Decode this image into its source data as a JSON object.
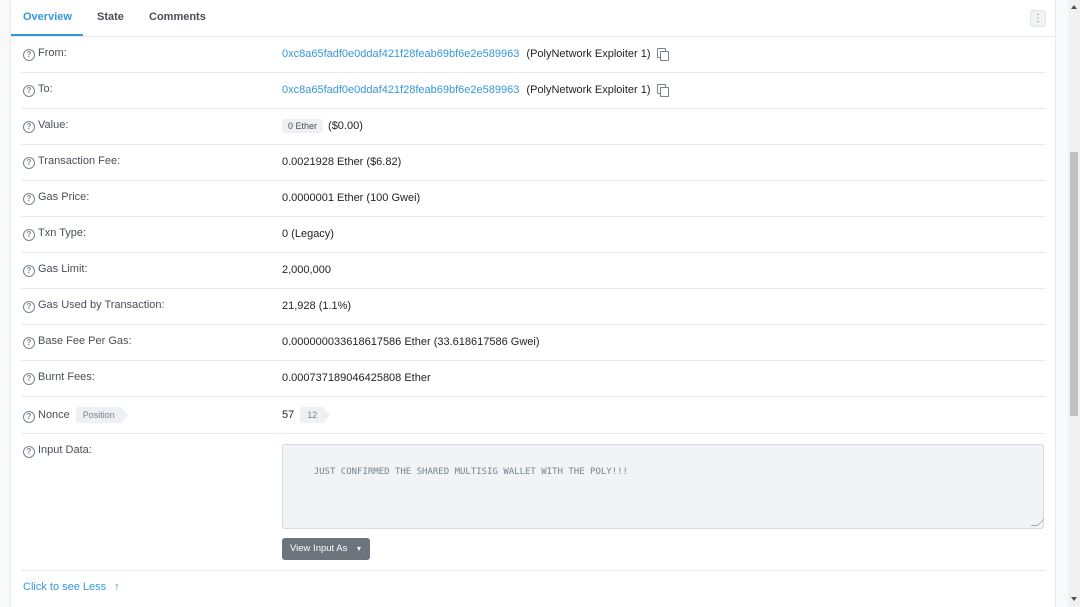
{
  "tabs": {
    "overview": "Overview",
    "state": "State",
    "comments": "Comments",
    "more_icon": "⋮"
  },
  "help_icon": "?",
  "rows": {
    "from": {
      "label": "From:",
      "address": "0xc8a65fadf0e0ddaf421f28feab69bf6e2e589963",
      "name": "(PolyNetwork Exploiter 1)"
    },
    "to": {
      "label": "To:",
      "address": "0xc8a65fadf0e0ddaf421f28feab69bf6e2e589963",
      "name": "(PolyNetwork Exploiter 1)"
    },
    "value": {
      "label": "Value:",
      "badge": "0 Ether",
      "usd": "($0.00)"
    },
    "txn_fee": {
      "label": "Transaction Fee:",
      "value": "0.0021928 Ether ($6.82)"
    },
    "gas_price": {
      "label": "Gas Price:",
      "value": "0.0000001 Ether (100 Gwei)"
    },
    "txn_type": {
      "label": "Txn Type:",
      "value": "0 (Legacy)"
    },
    "gas_limit": {
      "label": "Gas Limit:",
      "value": "2,000,000"
    },
    "gas_used": {
      "label": "Gas Used by Transaction:",
      "value": "21,928 (1.1%)"
    },
    "base_fee": {
      "label": "Base Fee Per Gas:",
      "value": "0.000000033618617586 Ether (33.618617586 Gwei)"
    },
    "burnt_fees": {
      "label": "Burnt Fees:",
      "value": "0.000737189046425808 Ether"
    },
    "nonce": {
      "label": "Nonce",
      "position_tag": "Position",
      "value": "57",
      "position": "12"
    },
    "input_data": {
      "label": "Input Data:",
      "text": "JUST CONFIRMED THE SHARED MULTISIG WALLET WITH THE POLY!!!"
    }
  },
  "view_input_as": {
    "label": "View Input As",
    "chevron": "▾"
  },
  "see_less": {
    "label": "Click to see Less",
    "arrow": "↑"
  },
  "colors": {
    "link": "#3498db",
    "button": "#6c757e",
    "border": "#e7eaf3"
  }
}
